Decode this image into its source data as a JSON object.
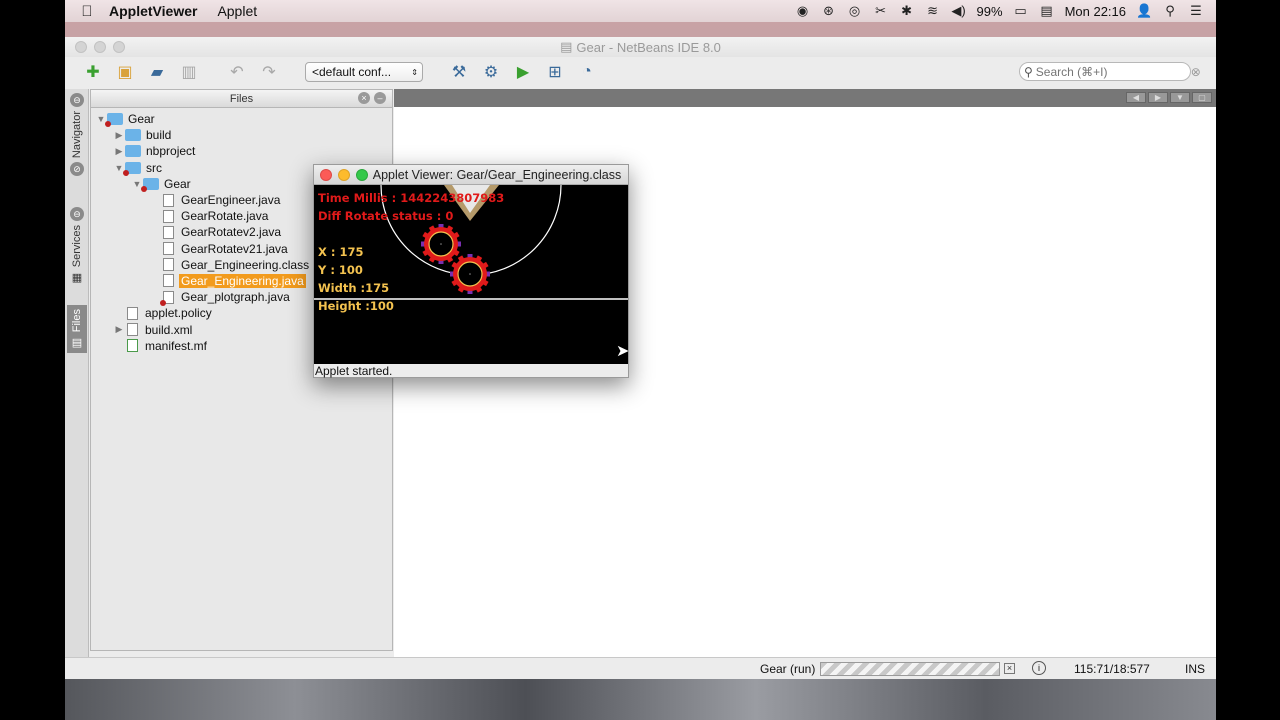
{
  "menubar": {
    "apple": "",
    "app_name": "AppletViewer",
    "menu_applet": "Applet",
    "battery": "99%",
    "clock": "Mon 22:16"
  },
  "ide": {
    "title": "Gear - NetBeans IDE 8.0",
    "config": "<default conf...",
    "search_placeholder": "Search (⌘+I)"
  },
  "side_tabs": {
    "navigator": "Navigator",
    "services": "Services",
    "files": "Files"
  },
  "files_panel": {
    "title": "Files",
    "tree": [
      {
        "label": "Gear",
        "level": 0,
        "kind": "folder-red",
        "expanded": true
      },
      {
        "label": "build",
        "level": 1,
        "kind": "folder",
        "expanded": false
      },
      {
        "label": "nbproject",
        "level": 1,
        "kind": "folder",
        "expanded": false
      },
      {
        "label": "src",
        "level": 1,
        "kind": "folder-red",
        "expanded": true
      },
      {
        "label": "Gear",
        "level": 2,
        "kind": "folder-red",
        "expanded": true
      },
      {
        "label": "GearEngineer.java",
        "level": 3,
        "kind": "file"
      },
      {
        "label": "GearRotate.java",
        "level": 3,
        "kind": "file"
      },
      {
        "label": "GearRotatev2.java",
        "level": 3,
        "kind": "file"
      },
      {
        "label": "GearRotatev21.java",
        "level": 3,
        "kind": "file"
      },
      {
        "label": "Gear_Engineering.class",
        "level": 3,
        "kind": "file"
      },
      {
        "label": "Gear_Engineering.java",
        "level": 3,
        "kind": "file",
        "selected": true
      },
      {
        "label": "Gear_plotgraph.java",
        "level": 3,
        "kind": "file-red"
      },
      {
        "label": "applet.policy",
        "level": 1,
        "kind": "file"
      },
      {
        "label": "build.xml",
        "level": 1,
        "kind": "file",
        "expanded": false
      },
      {
        "label": "manifest.mf",
        "level": 1,
        "kind": "file-green"
      }
    ]
  },
  "applet": {
    "title": "Applet Viewer: Gear/Gear_Engineering.class",
    "time_millis": "Time Millis : 1442243807983",
    "diff_rotate": "Diff Rotate status : 0",
    "x": "X : 175",
    "y": "Y : 100",
    "width": "Width :175",
    "height": "Height :100",
    "status": "Applet started."
  },
  "statusbar": {
    "task": "Gear (run)",
    "position": "115:71/18:577",
    "mode": "INS"
  },
  "colors": {
    "selection": "#f29b1d",
    "gear_red": "#e01a1a",
    "label_yellow": "#f3c24f"
  }
}
